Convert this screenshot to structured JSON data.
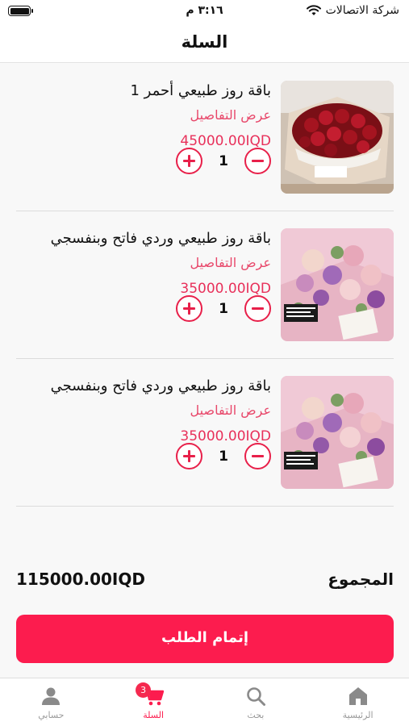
{
  "status_bar": {
    "carrier": "شركة الاتصالات",
    "time": "٣:١٦ م"
  },
  "header": {
    "title": "السلة"
  },
  "cart": {
    "items": [
      {
        "name": "باقة روز طبيعي أحمر 1",
        "details_label": "عرض التفاصيل",
        "price": "45000.00IQD",
        "quantity": "1"
      },
      {
        "name": "باقة روز طبيعي وردي فاتح وبنفسجي",
        "details_label": "عرض التفاصيل",
        "price": "35000.00IQD",
        "quantity": "1"
      },
      {
        "name": "باقة روز طبيعي وردي فاتح وبنفسجي",
        "details_label": "عرض التفاصيل",
        "price": "35000.00IQD",
        "quantity": "1"
      }
    ],
    "total_label": "المجموع",
    "total": "115000.00IQD",
    "checkout_label": "إتمام الطلب"
  },
  "tabs": [
    {
      "label": "حسابي",
      "icon": "person-icon"
    },
    {
      "label": "السلة",
      "icon": "cart-icon",
      "badge": "3",
      "active": true
    },
    {
      "label": "بحث",
      "icon": "search-icon"
    },
    {
      "label": "الرئيسية",
      "icon": "home-icon"
    }
  ],
  "colors": {
    "accent": "#fc1c4e",
    "price": "#e8305a",
    "link": "#e8476a"
  }
}
